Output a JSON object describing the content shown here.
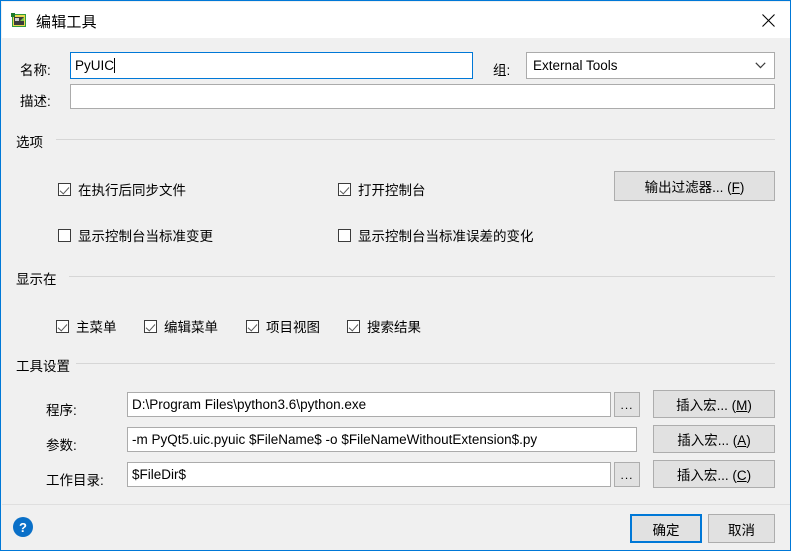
{
  "window": {
    "title": "编辑工具",
    "icon": "app-icon",
    "close_label": "×"
  },
  "form": {
    "name_label": "名称:",
    "name_value": "PyUIC",
    "group_label": "组:",
    "group_value": "External Tools",
    "description_label": "描述:",
    "description_value": ""
  },
  "options": {
    "title": "选项",
    "checkboxes": [
      {
        "label": "在执行后同步文件",
        "checked": true
      },
      {
        "label": "打开控制台",
        "checked": true
      },
      {
        "label": "显示控制台当标准变更",
        "checked": false
      },
      {
        "label": "显示控制台当标准误差的变化",
        "checked": false
      }
    ],
    "output_filter_button": "输出过滤器... (F)",
    "output_filter_accel": "F"
  },
  "show_in": {
    "title": "显示在",
    "checkboxes": [
      {
        "label": "主菜单",
        "checked": true
      },
      {
        "label": "编辑菜单",
        "checked": true
      },
      {
        "label": "项目视图",
        "checked": true
      },
      {
        "label": "搜索结果",
        "checked": true
      }
    ]
  },
  "tool_settings": {
    "title": "工具设置",
    "rows": [
      {
        "label": "程序:",
        "value": "D:\\Program Files\\python3.6\\python.exe",
        "browse": "...",
        "macro_button": "插入宏... (M)",
        "macro_accel": "M",
        "has_browse": true
      },
      {
        "label": "参数:",
        "value": "-m PyQt5.uic.pyuic  $FileName$ -o $FileNameWithoutExtension$.py",
        "browse": "",
        "macro_button": "插入宏... (A)",
        "macro_accel": "A",
        "has_browse": false
      },
      {
        "label": "工作目录:",
        "value": "$FileDir$",
        "browse": "...",
        "macro_button": "插入宏... (C)",
        "macro_accel": "C",
        "has_browse": true
      }
    ]
  },
  "footer": {
    "help_glyph": "?",
    "ok_label": "确定",
    "cancel_label": "取消"
  },
  "colors": {
    "accent": "#0078d7",
    "dialog_bg": "#f0f0f0",
    "titlebar_bg": "#ffffff",
    "button_bg": "#e1e1e1",
    "help_blue": "#0a70c8"
  }
}
